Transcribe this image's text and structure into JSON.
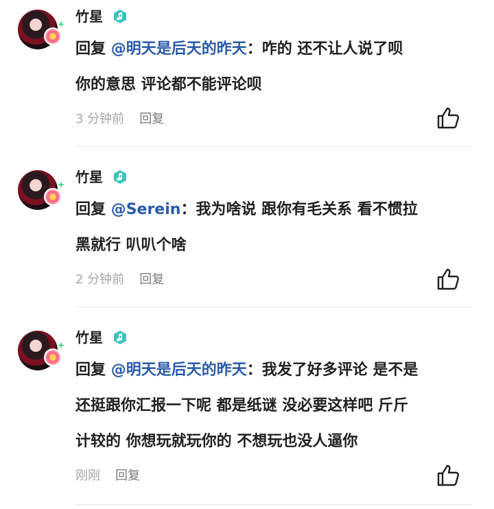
{
  "badge_color": "#3cc3c0",
  "mention_color": "#2a5aa8",
  "comments": [
    {
      "user": "竹星",
      "reply_prefix": "回复",
      "mention": "@明天是后天的昨天",
      "separator": "：",
      "line1": "咋的 还不让人说了呗",
      "line2": "你的意思 评论都不能评论呗",
      "line3": "",
      "time": "3 分钟前",
      "reply": "回复"
    },
    {
      "user": "竹星",
      "reply_prefix": "回复",
      "mention": "@Serein",
      "separator": "：",
      "line1": "我为啥说 跟你有毛关系 看不惯拉",
      "line2": "黑就行 叭叭个啥",
      "line3": "",
      "time": "2 分钟前",
      "reply": "回复"
    },
    {
      "user": "竹星",
      "reply_prefix": "回复",
      "mention": "@明天是后天的昨天",
      "separator": "：",
      "line1": "我发了好多评论 是不是",
      "line2": "还挺跟你汇报一下呢 都是纸谜 没必要这样吧 斤斤",
      "line3": "计较的 你想玩就玩你的 不想玩也没人逼你",
      "time": "刚刚",
      "reply": "回复"
    }
  ]
}
